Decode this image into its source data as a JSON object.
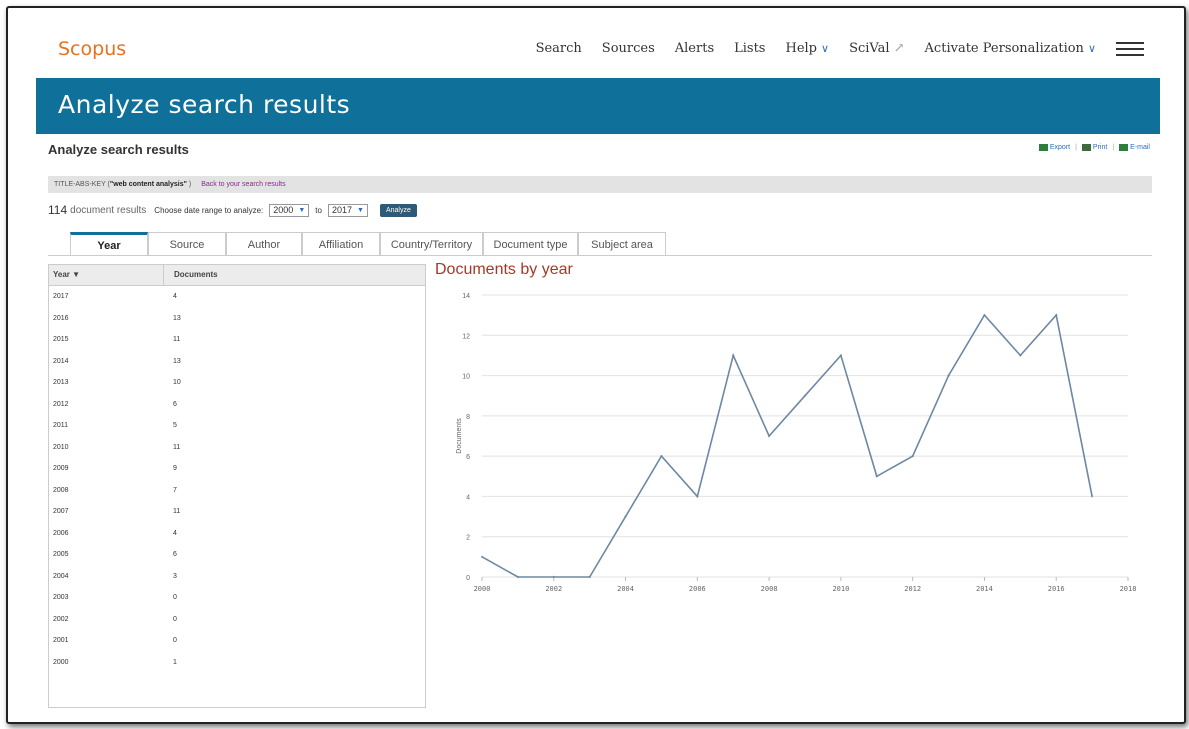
{
  "nav": {
    "logo": "Scopus",
    "search": "Search",
    "sources": "Sources",
    "alerts": "Alerts",
    "lists": "Lists",
    "help": "Help",
    "scival": "SciVal",
    "activate": "Activate Personalization"
  },
  "banner": {
    "title": "Analyze search results"
  },
  "page": {
    "subtitle": "Analyze search results",
    "export": "Export",
    "print": "Print",
    "email": "E-mail"
  },
  "query": {
    "prefix": "TITLE-ABS-KEY (",
    "term": "\"web content analysis\"",
    "suffix": ")",
    "back": "Back to your search results"
  },
  "controls": {
    "count": "114",
    "count_label": "document results",
    "range_label": "Choose date range to analyze:",
    "from": "2000",
    "to_label": "to",
    "to": "2017",
    "analyze": "Analyze"
  },
  "tabs": [
    "Year",
    "Source",
    "Author",
    "Affiliation",
    "Country/Territory",
    "Document type",
    "Subject area"
  ],
  "table": {
    "col_year": "Year ▼",
    "col_docs": "Documents",
    "rows": [
      {
        "year": "2017",
        "docs": "4"
      },
      {
        "year": "2016",
        "docs": "13"
      },
      {
        "year": "2015",
        "docs": "11"
      },
      {
        "year": "2014",
        "docs": "13"
      },
      {
        "year": "2013",
        "docs": "10"
      },
      {
        "year": "2012",
        "docs": "6"
      },
      {
        "year": "2011",
        "docs": "5"
      },
      {
        "year": "2010",
        "docs": "11"
      },
      {
        "year": "2009",
        "docs": "9"
      },
      {
        "year": "2008",
        "docs": "7"
      },
      {
        "year": "2007",
        "docs": "11"
      },
      {
        "year": "2006",
        "docs": "4"
      },
      {
        "year": "2005",
        "docs": "6"
      },
      {
        "year": "2004",
        "docs": "3"
      },
      {
        "year": "2003",
        "docs": "0"
      },
      {
        "year": "2002",
        "docs": "0"
      },
      {
        "year": "2001",
        "docs": "0"
      },
      {
        "year": "2000",
        "docs": "1"
      }
    ]
  },
  "chart_data": {
    "type": "line",
    "title": "Documents by year",
    "xlabel": "",
    "ylabel": "Documents",
    "x": [
      2000,
      2001,
      2002,
      2003,
      2004,
      2005,
      2006,
      2007,
      2008,
      2009,
      2010,
      2011,
      2012,
      2013,
      2014,
      2015,
      2016,
      2017
    ],
    "series": [
      {
        "values": [
          1,
          0,
          0,
          0,
          3,
          6,
          4,
          11,
          7,
          9,
          11,
          5,
          6,
          10,
          13,
          11,
          13,
          4
        ]
      }
    ],
    "xlim": [
      2000,
      2018
    ],
    "ylim": [
      0,
      14
    ],
    "xticks": [
      2000,
      2002,
      2004,
      2006,
      2008,
      2010,
      2012,
      2014,
      2016,
      2018
    ],
    "yticks": [
      0,
      2,
      4,
      6,
      8,
      10,
      12,
      14
    ],
    "grid": true,
    "color": "#6e88a3"
  }
}
